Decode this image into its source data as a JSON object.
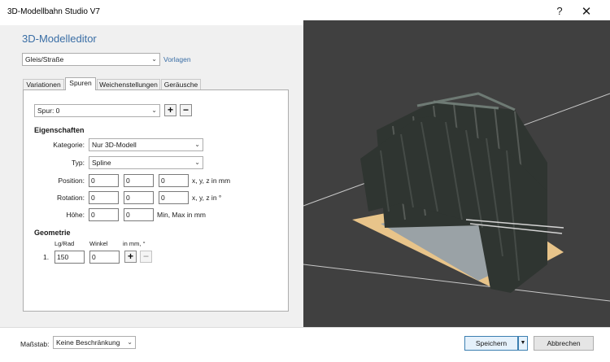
{
  "window": {
    "title": "3D-Modellbahn Studio V7",
    "help": "?",
    "close": "✕"
  },
  "editor": {
    "title": "3D-Modelleditor",
    "category_select": "Gleis/Straße",
    "templates_link": "Vorlagen",
    "tabs": [
      "Variationen",
      "Spuren",
      "Weichenstellungen",
      "Geräusche"
    ],
    "active_tab": "Spuren"
  },
  "spuren": {
    "track_select": "Spur: 0",
    "properties_heading": "Eigenschaften",
    "kategorie_label": "Kategorie:",
    "kategorie_value": "Nur 3D-Modell",
    "typ_label": "Typ:",
    "typ_value": "Spline",
    "position_label": "Position:",
    "position": [
      "0",
      "0",
      "0"
    ],
    "position_unit": "x, y, z in mm",
    "rotation_label": "Rotation:",
    "rotation": [
      "0",
      "0",
      "0"
    ],
    "rotation_unit": "x, y, z in °",
    "hoehe_label": "Höhe:",
    "hoehe": [
      "0",
      "0"
    ],
    "hoehe_unit": "Min, Max in mm",
    "geometry_heading": "Geometrie",
    "geo_col1": "Lg/Rad",
    "geo_col2": "Winkel",
    "geo_col3": "in mm, °",
    "rows": [
      {
        "index": "1.",
        "lg_rad": "150",
        "winkel": "0"
      }
    ],
    "plus": "+",
    "minus": "−"
  },
  "bottom": {
    "scale_label": "Maßstab:",
    "scale_value": "Keine Beschränkung",
    "save_label": "Speichern",
    "cancel_label": "Abbrechen"
  },
  "icons": {
    "dropdown": "chevron-down-icon",
    "add": "plus-icon",
    "remove": "minus-icon"
  },
  "colors": {
    "accent": "#3a6ea5",
    "viewport_bg": "#404040",
    "bridge_steel": "#2f3531",
    "deck_wood": "#e8c48a"
  }
}
